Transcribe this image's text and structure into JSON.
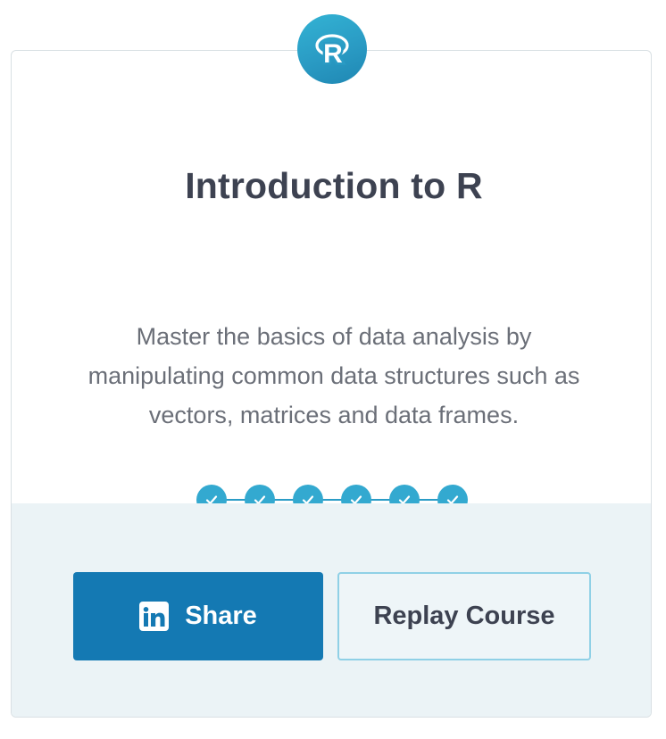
{
  "course": {
    "logo_letter": "R",
    "title": "Introduction to R",
    "description": "Master the basics of data analysis by manipulating common data structures such as vectors, matrices and data frames."
  },
  "progress": {
    "chapters_completed": 6,
    "chapters_total": 6,
    "check_icon": "check-icon"
  },
  "actions": {
    "share_label": "Share",
    "share_icon": "linkedin-icon",
    "replay_label": "Replay Course"
  },
  "colors": {
    "accent": "#33a9d0",
    "share_button": "#1479b3",
    "footer_bg": "#ebf3f6",
    "title_text": "#3d4251"
  }
}
